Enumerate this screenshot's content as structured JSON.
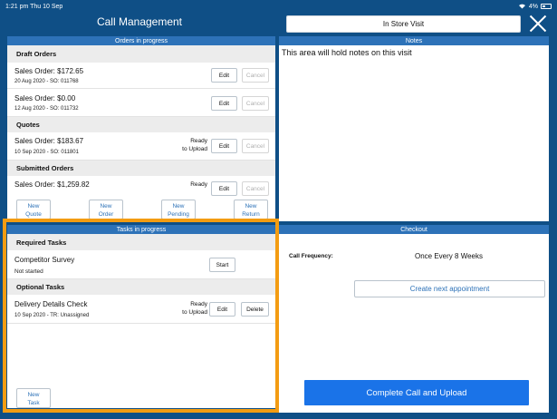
{
  "status_bar": {
    "time_date": "1:21 pm  Thu 10 Sep",
    "battery_text": "4%"
  },
  "header": {
    "title": "Call Management",
    "visit_type": "In Store Visit"
  },
  "orders_panel": {
    "title": "Orders in progress",
    "sections": {
      "draft": {
        "label": "Draft Orders",
        "items": [
          {
            "title": "Sales Order: $172.65",
            "sub": "20 Aug 2020 - SO: 011768",
            "edit": "Edit",
            "cancel": "Cancel"
          },
          {
            "title": "Sales Order: $0.00",
            "sub": "12 Aug 2020 - SO: 011732",
            "edit": "Edit",
            "cancel": "Cancel"
          }
        ]
      },
      "quotes": {
        "label": "Quotes",
        "items": [
          {
            "title": "Sales Order: $183.67",
            "sub": "10 Sep 2020 - SO: 011801",
            "status": "Ready\nto Upload",
            "edit": "Edit",
            "cancel": "Cancel"
          }
        ]
      },
      "submitted": {
        "label": "Submitted Orders",
        "items": [
          {
            "title": "Sales Order: $1,259.82",
            "status": "Ready",
            "edit": "Edit",
            "cancel": "Cancel"
          }
        ]
      }
    },
    "new_buttons": {
      "quote": "New\nQuote",
      "order": "New\nOrder",
      "pending": "New\nPending",
      "return": "New\nReturn"
    }
  },
  "tasks_panel": {
    "title": "Tasks in progress",
    "required": {
      "label": "Required Tasks",
      "items": [
        {
          "title": "Competitor Survey",
          "sub": "Not started",
          "start": "Start"
        }
      ]
    },
    "optional": {
      "label": "Optional Tasks",
      "items": [
        {
          "title": "Delivery Details Check",
          "sub": "10 Sep 2020 - TR: Unassigned",
          "status": "Ready\nto Upload",
          "edit": "Edit",
          "delete": "Delete"
        }
      ]
    },
    "new_task": "New\nTask"
  },
  "notes_panel": {
    "title": "Notes",
    "text": "This area will hold notes on this visit"
  },
  "checkout_panel": {
    "title": "Checkout",
    "call_frequency_label": "Call Frequency:",
    "call_frequency_value": "Once Every 8 Weeks",
    "create_appointment": "Create next appointment",
    "complete_button": "Complete Call and Upload"
  },
  "colors": {
    "background": "#0f4f86",
    "panel_header": "#2d72b8",
    "highlight": "#f39c12",
    "primary_button": "#1a73e8"
  }
}
